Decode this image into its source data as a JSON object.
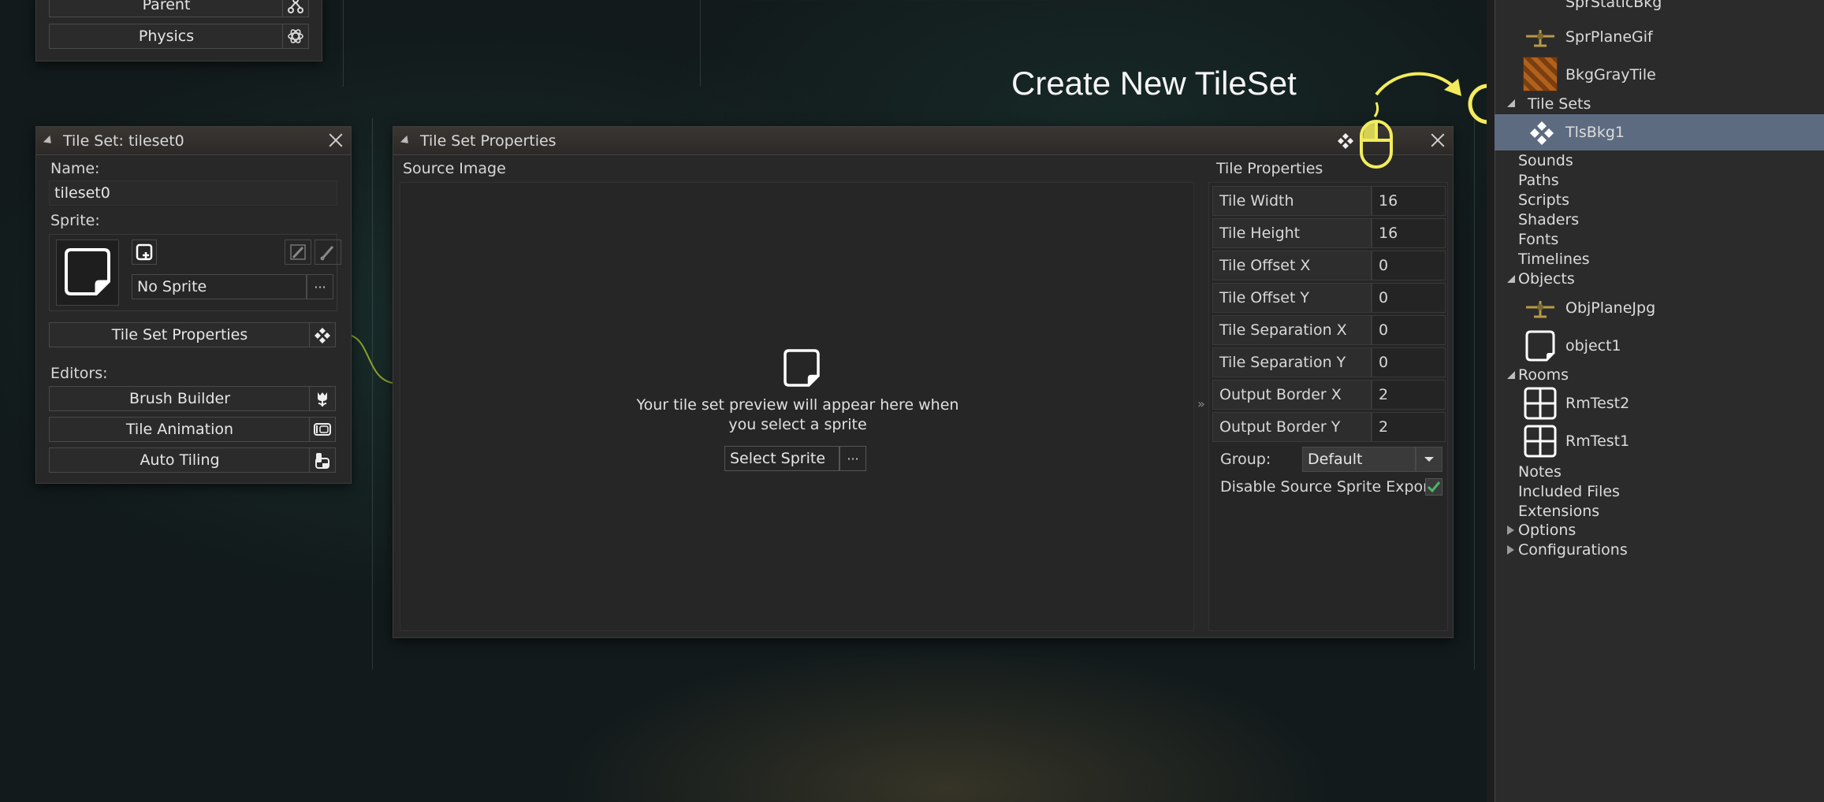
{
  "annotation": {
    "text": "Create New TileSet",
    "color": "#f2ec5c"
  },
  "top_panel": {
    "parent_label": "Parent",
    "physics_label": "Physics"
  },
  "tileset_panel": {
    "title": "Tile Set: tileset0",
    "name_label": "Name:",
    "name_value": "tileset0",
    "sprite_label": "Sprite:",
    "sprite_value": "No Sprite",
    "sprite_more": "···",
    "properties_button": "Tile Set Properties",
    "editors_label": "Editors:",
    "editors": [
      {
        "label": "Brush Builder",
        "icon": "tulip-icon"
      },
      {
        "label": "Tile Animation",
        "icon": "film-icon"
      },
      {
        "label": "Auto Tiling",
        "icon": "auto-tile-icon"
      }
    ]
  },
  "properties_window": {
    "title": "Tile Set Properties",
    "source_image_label": "Source Image",
    "preview_text_line1": "Your tile set preview will appear here when",
    "preview_text_line2": "you select a sprite",
    "select_sprite_label": "Select Sprite",
    "select_more": "···",
    "collapse_glyph": "»",
    "tile_properties_label": "Tile Properties",
    "props": [
      {
        "name": "Tile Width",
        "value": "16"
      },
      {
        "name": "Tile Height",
        "value": "16"
      },
      {
        "name": "Tile Offset X",
        "value": "0"
      },
      {
        "name": "Tile Offset Y",
        "value": "0"
      },
      {
        "name": "Tile Separation X",
        "value": "0"
      },
      {
        "name": "Tile Separation Y",
        "value": "0"
      },
      {
        "name": "Output Border X",
        "value": "2"
      },
      {
        "name": "Output Border Y",
        "value": "2"
      }
    ],
    "group_label": "Group:",
    "group_value": "Default",
    "disable_export_label": "Disable Source Sprite Export",
    "disable_export_checked": true
  },
  "resource_tree": {
    "items": [
      {
        "label": "SprStaticBkg",
        "kind": "resource"
      },
      {
        "label": "SprPlaneGif",
        "kind": "resource",
        "icon": "plane-sprite-icon"
      },
      {
        "label": "BkgGrayTile",
        "kind": "resource",
        "icon": "tile-sprite-icon"
      },
      {
        "label": "Tile Sets",
        "kind": "folder-open"
      },
      {
        "label": "TlsBkg1",
        "kind": "resource",
        "icon": "tileset-icon",
        "selected": true
      },
      {
        "label": "Sounds",
        "kind": "folder"
      },
      {
        "label": "Paths",
        "kind": "folder"
      },
      {
        "label": "Scripts",
        "kind": "folder"
      },
      {
        "label": "Shaders",
        "kind": "folder"
      },
      {
        "label": "Fonts",
        "kind": "folder"
      },
      {
        "label": "Timelines",
        "kind": "folder"
      },
      {
        "label": "Objects",
        "kind": "folder-open"
      },
      {
        "label": "ObjPlaneJpg",
        "kind": "resource",
        "icon": "plane-sprite-icon"
      },
      {
        "label": "object1",
        "kind": "resource",
        "icon": "object-icon"
      },
      {
        "label": "Rooms",
        "kind": "folder-open"
      },
      {
        "label": "RmTest2",
        "kind": "resource",
        "icon": "room-icon"
      },
      {
        "label": "RmTest1",
        "kind": "resource",
        "icon": "room-icon"
      },
      {
        "label": "Notes",
        "kind": "folder"
      },
      {
        "label": "Included Files",
        "kind": "folder"
      },
      {
        "label": "Extensions",
        "kind": "folder"
      },
      {
        "label": "Options",
        "kind": "folder-filled"
      },
      {
        "label": "Configurations",
        "kind": "folder-filled"
      }
    ]
  }
}
